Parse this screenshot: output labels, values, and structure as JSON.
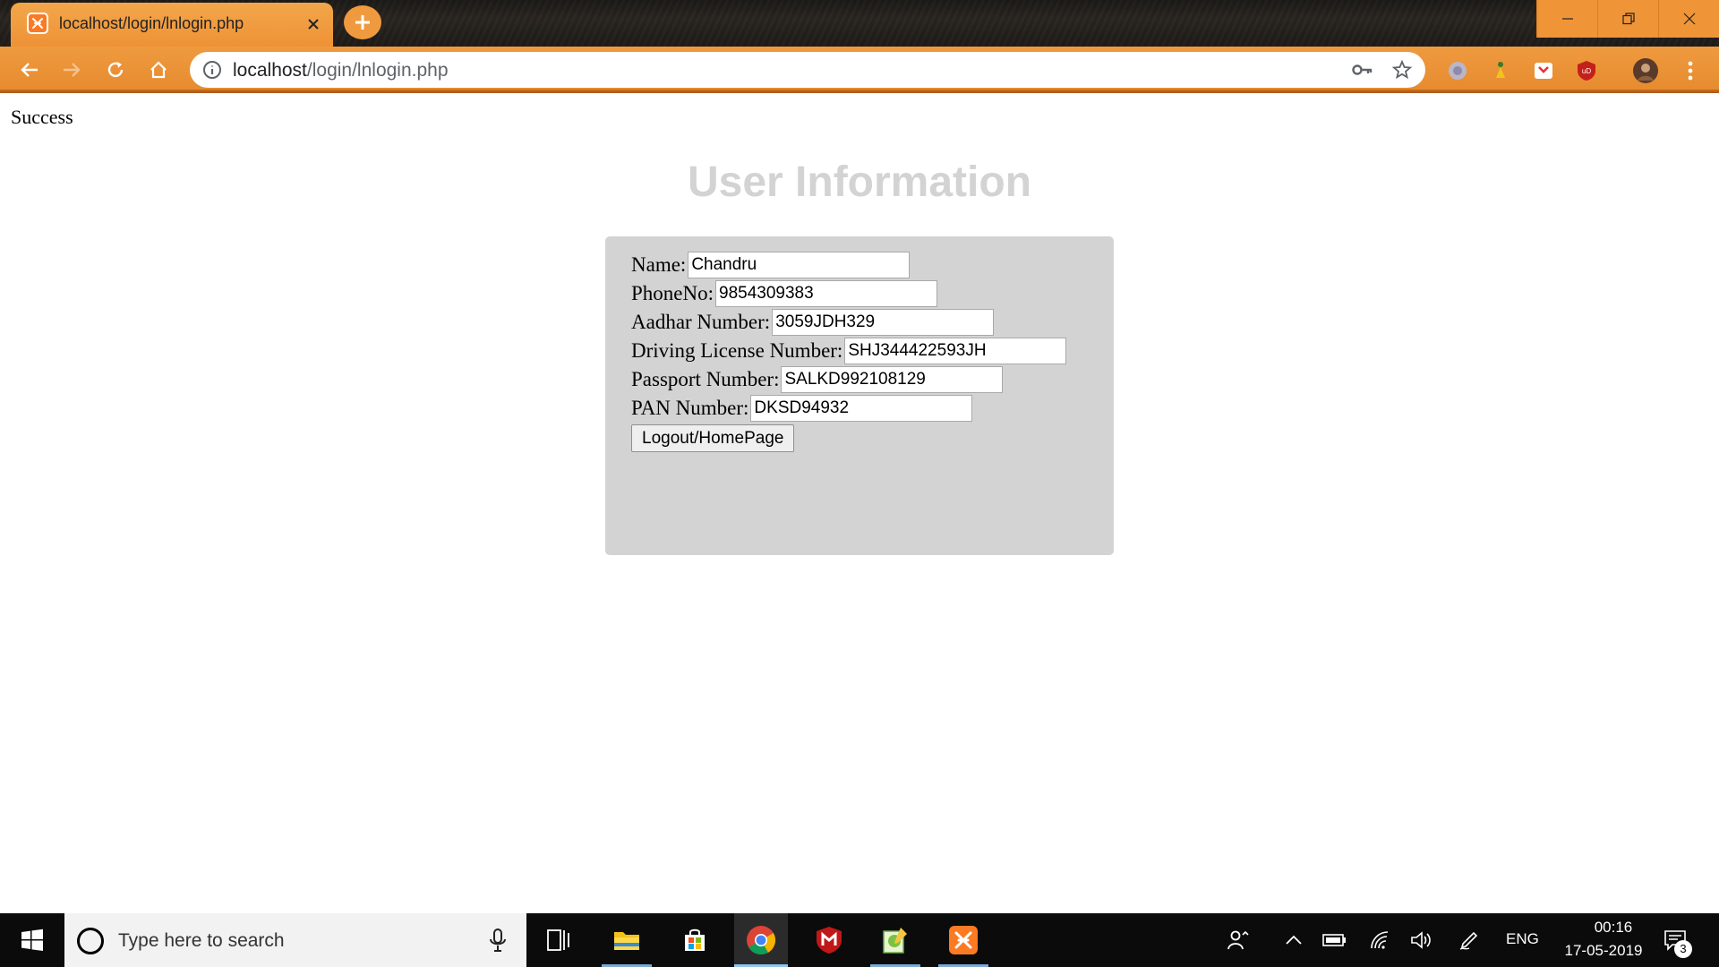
{
  "browser": {
    "tab_title": "localhost/login/lnlogin.php",
    "url_host": "localhost",
    "url_path": "/login/lnlogin.php",
    "accent_color": "#ef9538"
  },
  "page": {
    "status_text": "Success",
    "heading": "User Information",
    "heading_color": "#d3d3d3",
    "card_color": "#d3d3d3",
    "fields": [
      {
        "label": "Name:",
        "value": "Chandru"
      },
      {
        "label": "PhoneNo:",
        "value": "9854309383"
      },
      {
        "label": "Aadhar Number:",
        "value": "3059JDH329"
      },
      {
        "label": "Driving License Number:",
        "value": "SHJ344422593JH"
      },
      {
        "label": "Passport Number:",
        "value": "SALKD992108129"
      },
      {
        "label": "PAN Number:",
        "value": "DKSD94932"
      }
    ],
    "logout_label": "Logout/HomePage"
  },
  "taskbar": {
    "search_placeholder": "Type here to search",
    "language": "ENG",
    "time": "00:16",
    "date": "17-05-2019",
    "notification_count": "3"
  }
}
